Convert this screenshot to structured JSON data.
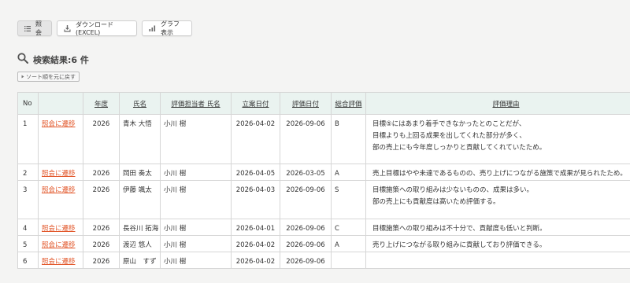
{
  "toolbar": {
    "inquiry_label": "照 会",
    "download_label": "ダウンロード(EXCEL)",
    "graph_label": "グラフ表示"
  },
  "search": {
    "result_label": "検索結果:6 件",
    "sort_reset_label": "ソート順を元に戻す"
  },
  "table": {
    "headers": {
      "no": "No",
      "link": "",
      "year": "年度",
      "name": "氏名",
      "evaluator": "評価担当者 氏名",
      "start_date": "立案日付",
      "eval_date": "評価日付",
      "overall": "総合評価",
      "reason": "評価理由"
    },
    "rows": [
      {
        "no": "1",
        "link": "照会に遷移",
        "year": "2026",
        "name": "青木 大悟",
        "evaluator": "小川 樹",
        "start_date": "2026-04-02",
        "eval_date": "2026-09-06",
        "overall": "B",
        "reason": [
          "目標⑤にはあまり着手できなかったとのことだが、",
          "目標よりも上回る成果を出してくれた部分が多く、",
          "部の売上にも今年度しっかりと貢献してくれていたため。"
        ]
      },
      {
        "no": "2",
        "link": "照会に遷移",
        "year": "2026",
        "name": "岡田 奏太",
        "evaluator": "小川 樹",
        "start_date": "2026-04-05",
        "eval_date": "2026-03-05",
        "overall": "A",
        "reason": [
          "売上目標はやや未達であるものの、売り上げにつながる施策で成果が見られたため。"
        ]
      },
      {
        "no": "3",
        "link": "照会に遷移",
        "year": "2026",
        "name": "伊藤 颯太",
        "evaluator": "小川 樹",
        "start_date": "2026-04-03",
        "eval_date": "2026-09-06",
        "overall": "S",
        "reason": [
          "目標施策への取り組みは少ないものの、成果は多い。",
          "部の売上にも貢献度は高いため評価する。"
        ]
      },
      {
        "no": "4",
        "link": "照会に遷移",
        "year": "2026",
        "name": "長谷川 拓海",
        "evaluator": "小川 樹",
        "start_date": "2026-04-01",
        "eval_date": "2026-09-06",
        "overall": "C",
        "reason": [
          "目標施策への取り組みは不十分で、貢献度も低いと判断。"
        ]
      },
      {
        "no": "5",
        "link": "照会に遷移",
        "year": "2026",
        "name": "渡辺 悠人",
        "evaluator": "小川 樹",
        "start_date": "2026-04-02",
        "eval_date": "2026-09-06",
        "overall": "A",
        "reason": [
          "売り上げにつながる取り組みに貢献しており評価できる。"
        ]
      },
      {
        "no": "6",
        "link": "照会に遷移",
        "year": "2026",
        "name": "原山　すず",
        "evaluator": "小川 樹",
        "start_date": "2026-04-02",
        "eval_date": "2026-09-06",
        "overall": "",
        "reason": []
      }
    ]
  }
}
